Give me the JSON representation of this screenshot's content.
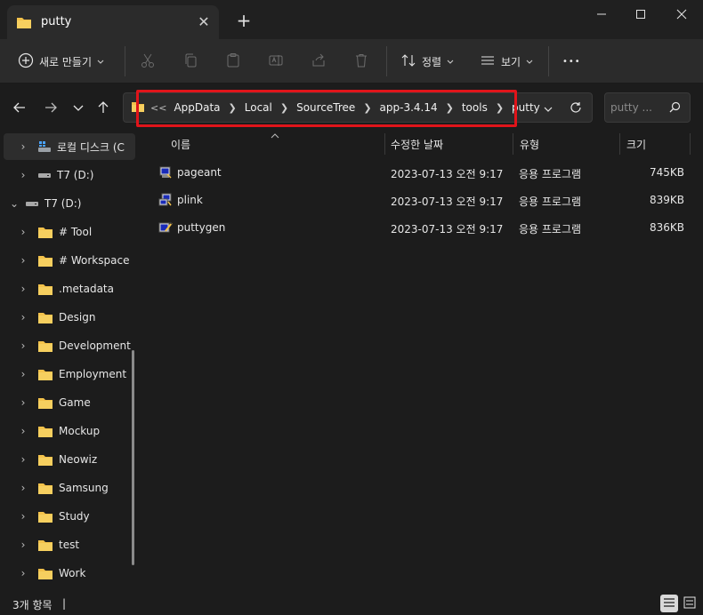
{
  "window": {
    "tab_title": "putty",
    "new_tab_symbol": "+"
  },
  "commandbar": {
    "new_label": "새로 만들기",
    "sort_label": "정렬",
    "view_label": "보기",
    "more_label": "•••"
  },
  "address": {
    "prefix": "<<",
    "crumbs": [
      "AppData",
      "Local",
      "SourceTree",
      "app-3.4.14",
      "tools",
      "putty"
    ]
  },
  "search": {
    "placeholder": "putty ..."
  },
  "sidebar": {
    "items": [
      {
        "label": "로컬 디스크 (C"
      },
      {
        "label": "T7 (D:)"
      },
      {
        "label": "T7 (D:)"
      },
      {
        "label": "# Tool"
      },
      {
        "label": "# Workspace"
      },
      {
        "label": ".metadata"
      },
      {
        "label": "Design"
      },
      {
        "label": "Development"
      },
      {
        "label": "Employment"
      },
      {
        "label": "Game"
      },
      {
        "label": "Mockup"
      },
      {
        "label": "Neowiz"
      },
      {
        "label": "Samsung"
      },
      {
        "label": "Study"
      },
      {
        "label": "test"
      },
      {
        "label": "Work"
      }
    ]
  },
  "columns": {
    "name": "이름",
    "date": "수정한 날짜",
    "type": "유형",
    "size": "크기"
  },
  "files": [
    {
      "name": "pageant",
      "date": "2023-07-13 오전 9:17",
      "type": "응용 프로그램",
      "size": "745KB"
    },
    {
      "name": "plink",
      "date": "2023-07-13 오전 9:17",
      "type": "응용 프로그램",
      "size": "839KB"
    },
    {
      "name": "puttygen",
      "date": "2023-07-13 오전 9:17",
      "type": "응용 프로그램",
      "size": "836KB"
    }
  ],
  "status": {
    "item_count": "3개 항목",
    "cursor": "|"
  },
  "colors": {
    "folder": "#f3c24b",
    "highlight": "#e0141a",
    "background": "#1c1c1c"
  },
  "icons": {
    "folder": "folder-icon",
    "exe": "putty-exe-icon",
    "drive": "drive-icon"
  }
}
